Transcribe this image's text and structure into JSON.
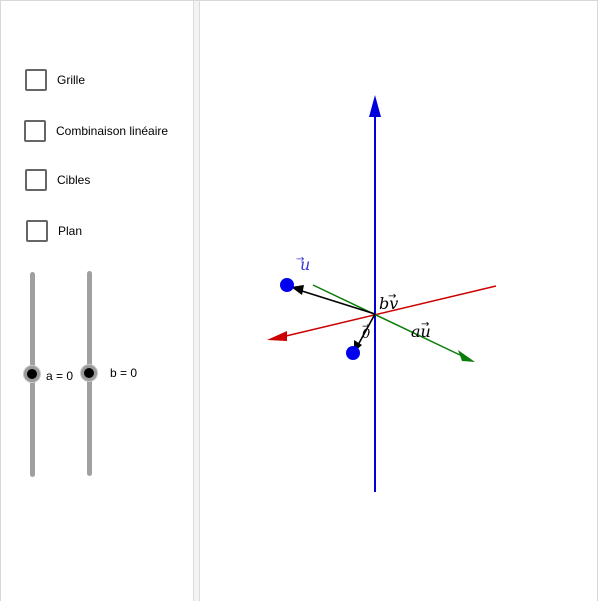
{
  "checkboxes": [
    {
      "label": "Grille",
      "checked": false
    },
    {
      "label": "Combinaison linéaire",
      "checked": false
    },
    {
      "label": "Cibles",
      "checked": false
    },
    {
      "label": "Plan",
      "checked": false
    }
  ],
  "sliders": [
    {
      "label": "a = 0",
      "value": 0
    },
    {
      "label": "b = 0",
      "value": 0
    }
  ],
  "vector_labels": {
    "u": "u",
    "bv": "bv",
    "au": "au",
    "origin": "0"
  },
  "colors": {
    "axis_vertical": "#0000dd",
    "axis_red": "#cc0000",
    "axis_green": "#0a7d0a",
    "point": "#0000ee",
    "vector": "#000000",
    "slider_track": "#a0a0a0",
    "label_blue": "#3b3bd6"
  }
}
